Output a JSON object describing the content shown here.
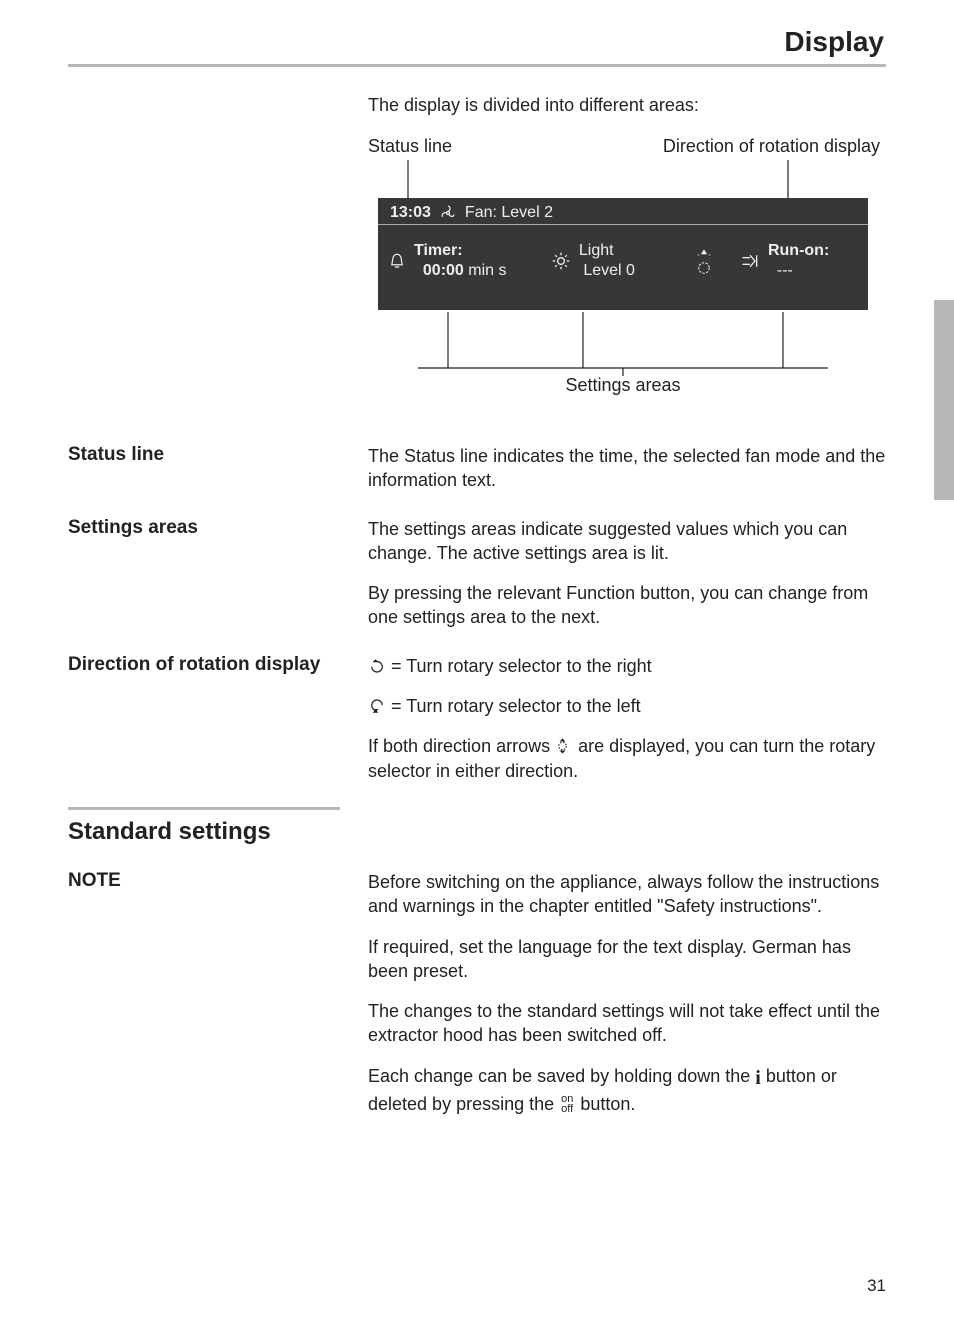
{
  "header": {
    "title": "Display"
  },
  "intro": "The display is divided into different areas:",
  "diagram_labels": {
    "status_line": "Status line",
    "rotation_display": "Direction of rotation display",
    "settings_areas": "Settings areas"
  },
  "display": {
    "time": "13:03",
    "fan_text": "Fan: Level 2",
    "timer": {
      "label": "Timer:",
      "value": "00:00",
      "unit": "min s"
    },
    "light": {
      "label": "Light",
      "value": "Level 0"
    },
    "runon": {
      "label": "Run-on:",
      "value": "---"
    }
  },
  "sections": {
    "status_line": {
      "heading": "Status line",
      "body": "The Status line indicates the time, the selected fan mode and the information text."
    },
    "settings_areas": {
      "heading": "Settings areas",
      "p1": "The settings areas indicate suggested values which you can change. The active settings area is lit.",
      "p2": "By pressing the relevant Function button, you can change from one settings area to the next."
    },
    "rotation": {
      "heading": "Direction of rotation display",
      "right_text": " = Turn rotary selector to the right",
      "left_text": " = Turn rotary selector to the left",
      "both_pre": "If both direction arrows ",
      "both_post": " are displayed, you can turn the rotary selector in either direction."
    }
  },
  "standard": {
    "heading": "Standard settings",
    "note_label": "NOTE",
    "p1": "Before switching on the appliance, always follow the instructions and warnings in the chapter entitled \"Safety instructions\".",
    "p2": "If required, set the language for the text display. German has been preset.",
    "p3": "The changes to the standard settings will not take effect until the extractor hood has been switched off.",
    "p4_pre": "Each change can be saved by holding down the ",
    "p4_mid": " button or deleted by pressing the ",
    "p4_post": " button.",
    "onoff_top": "on",
    "onoff_bot": "off"
  },
  "page_number": "31"
}
